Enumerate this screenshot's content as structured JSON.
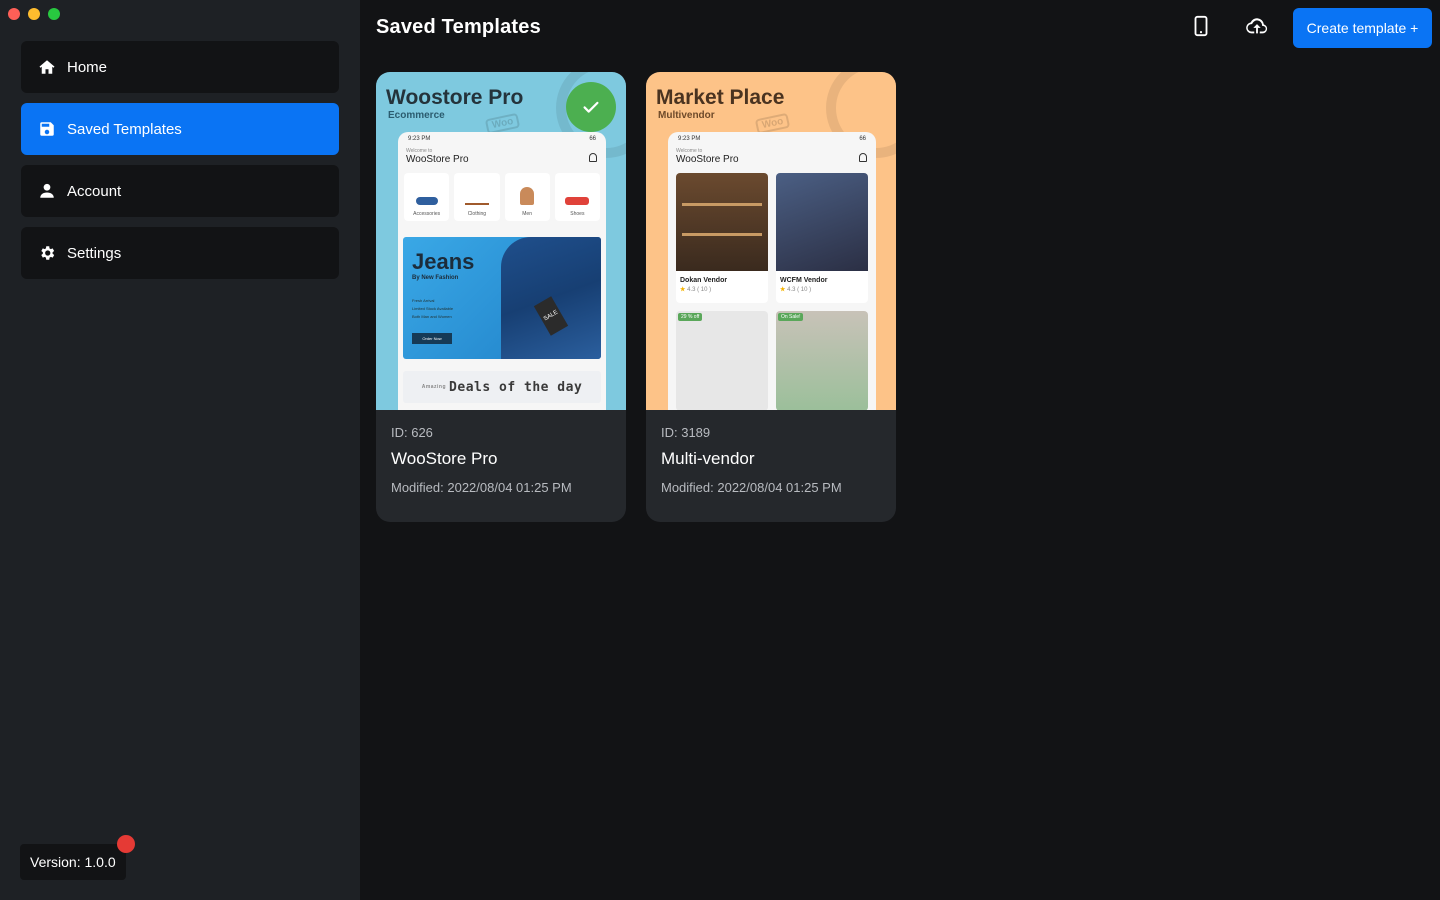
{
  "sidebar": {
    "items": [
      {
        "label": "Home",
        "icon": "home-icon",
        "active": false
      },
      {
        "label": "Saved Templates",
        "icon": "save-icon",
        "active": true
      },
      {
        "label": "Account",
        "icon": "person-icon",
        "active": false
      },
      {
        "label": "Settings",
        "icon": "gear-icon",
        "active": false
      }
    ],
    "version": "Version: 1.0.0"
  },
  "header": {
    "title": "Saved Templates",
    "create_label": "Create template +"
  },
  "templates": [
    {
      "id": "ID: 626",
      "name": "WooStore Pro",
      "modified": "Modified: 2022/08/04 01:25 PM",
      "selected": true,
      "preview": {
        "title": "Woostore Pro",
        "subtitle": "Ecommerce",
        "time": "9:23 PM",
        "battery": "66",
        "welcome": "Welcome to",
        "store": "WooStore Pro",
        "categories": [
          "Accessories",
          "Clothing",
          "Men",
          "Shoes"
        ],
        "banner_title": "Jeans",
        "banner_sub": "By New Fashion",
        "banner_lines": [
          "Fresh Arrival",
          "Limited Stock Available",
          "Both Man and Women"
        ],
        "banner_button": "Order Now",
        "tag": "SALE",
        "deals_small": "Amazing",
        "deals": "Deals of the day"
      }
    },
    {
      "id": "ID: 3189",
      "name": "Multi-vendor",
      "modified": "Modified: 2022/08/04 01:25 PM",
      "selected": false,
      "preview": {
        "title": "Market Place",
        "subtitle": "Multivendor",
        "time": "9:23 PM",
        "battery": "66",
        "welcome": "Welcome to",
        "store": "WooStore Pro",
        "vendors": [
          {
            "name": "Dokan Vendor",
            "rating": "4.3",
            "count": "( 10 )"
          },
          {
            "name": "WCFM Vendor",
            "rating": "4.3",
            "count": "( 10 )"
          }
        ],
        "badges": [
          "29 % off",
          "On Sale!"
        ]
      }
    }
  ],
  "colors": {
    "accent": "#0a74f4",
    "sidebar_bg": "#1e2125",
    "main_bg": "#121315",
    "card_bg": "#25282c",
    "selected_check": "#4caf50",
    "notification_dot": "#e53a35"
  }
}
